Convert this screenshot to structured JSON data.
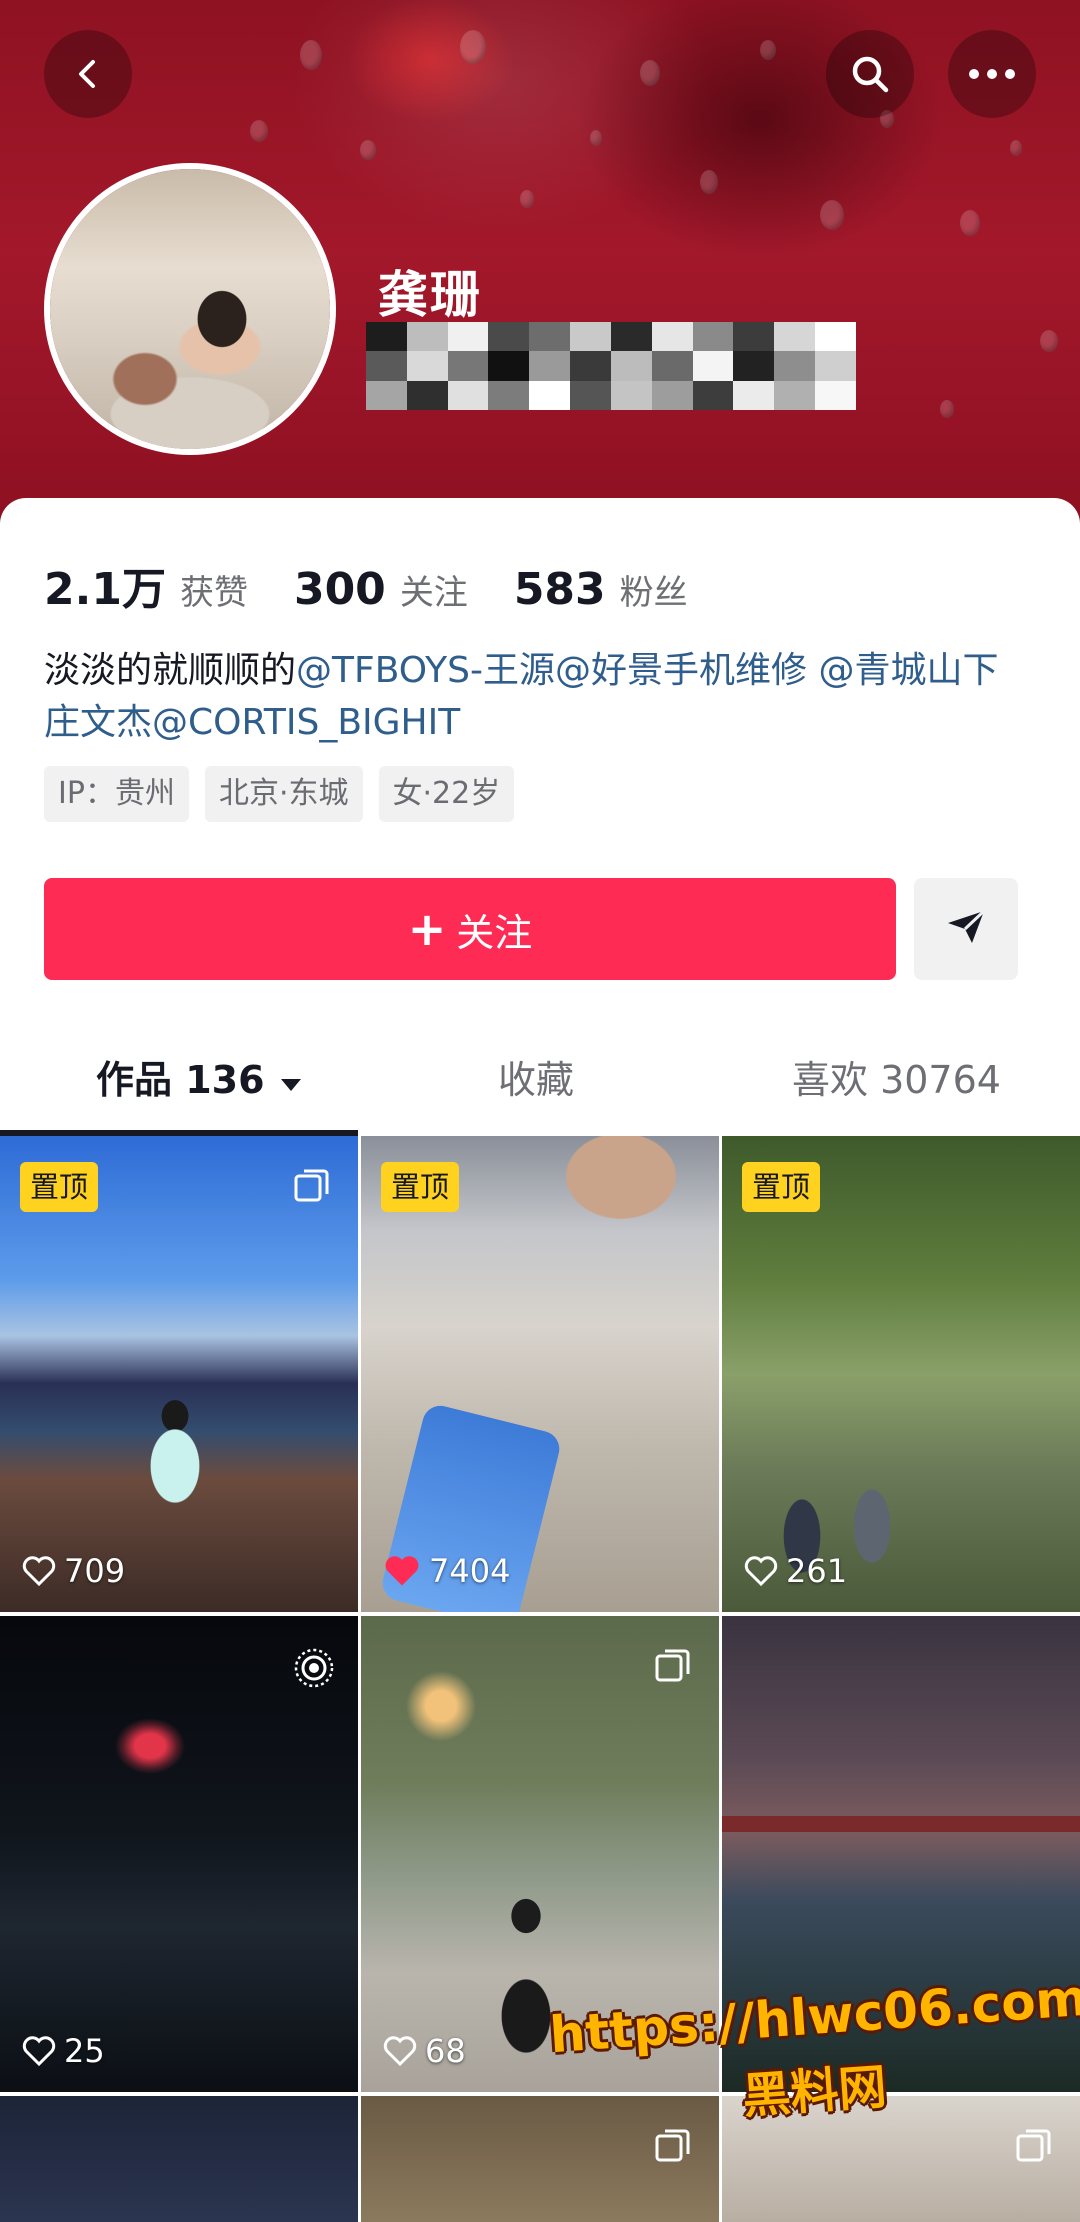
{
  "header": {
    "back_icon": "chevron-left-icon",
    "search_icon": "search-icon",
    "more_icon": "more-icon"
  },
  "profile": {
    "name": "龚珊",
    "stats": [
      {
        "value": "2.1万",
        "label": "获赞"
      },
      {
        "value": "300",
        "label": "关注"
      },
      {
        "value": "583",
        "label": "粉丝"
      }
    ],
    "bio": {
      "text": "淡淡的就顺顺的",
      "mentions": [
        "@TFBOYS-王源",
        "@好景手机维修 ",
        "@青城山下庄文杰",
        "@CORTIS_BIGHIT"
      ]
    },
    "tags": [
      "IP：贵州",
      "北京·东城",
      "女·22岁"
    ]
  },
  "actions": {
    "follow_label": "关注",
    "follow_plus": "+",
    "share_icon": "send-icon",
    "accent_color": "#fe2c55"
  },
  "tabs": {
    "works": "作品 136",
    "favorites": "收藏",
    "likes": "喜欢 30764"
  },
  "videos": [
    {
      "pinned": "置顶",
      "likes": "709",
      "multi": true
    },
    {
      "pinned": "置顶",
      "likes": "7404",
      "multi": false
    },
    {
      "pinned": "置顶",
      "likes": "261",
      "multi": false
    },
    {
      "pinned": "",
      "likes": "25",
      "live": true
    },
    {
      "pinned": "",
      "likes": "68",
      "multi": true
    },
    {
      "pinned": "",
      "likes": "",
      "multi": false
    },
    {
      "pinned": "",
      "likes": "",
      "multi": false
    },
    {
      "pinned": "",
      "likes": "",
      "multi": true
    },
    {
      "pinned": "",
      "likes": "",
      "multi": true
    }
  ],
  "watermark": {
    "url": "https://hlwc06.com",
    "cn": "黑料网"
  }
}
